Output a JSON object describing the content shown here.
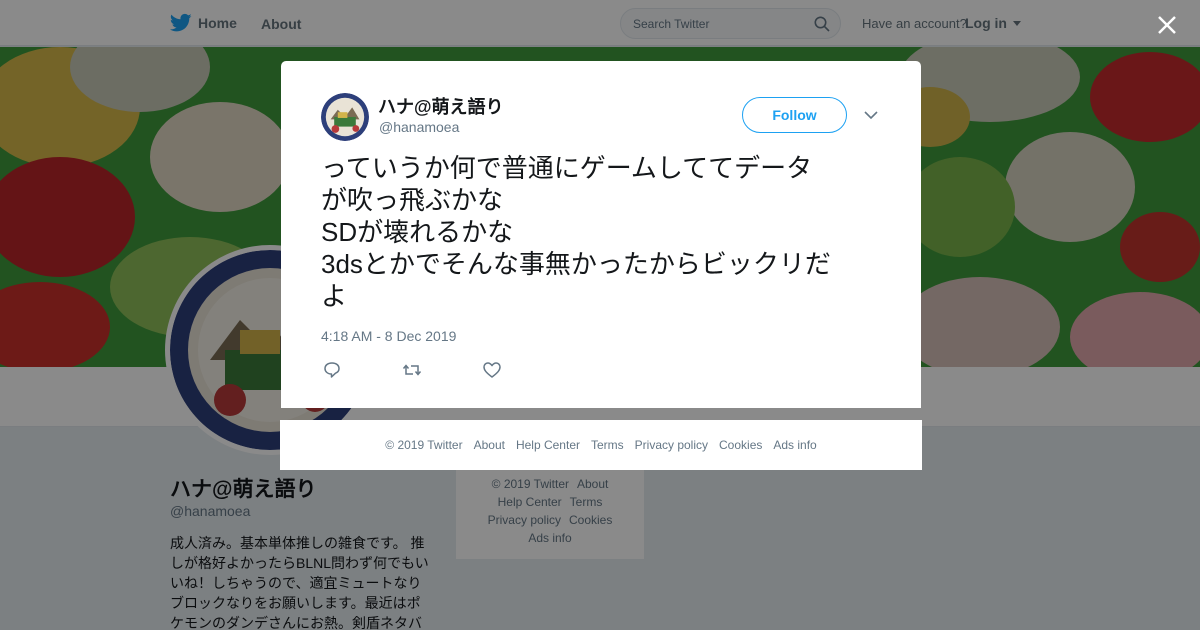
{
  "topbar": {
    "home_label": "Home",
    "about_label": "About",
    "search_placeholder": "Search Twitter",
    "have_account": "Have an account?",
    "login_label": "Log in"
  },
  "profile": {
    "name": "ハナ@萌え語り",
    "handle": "@hanamoea",
    "bio": "成人済み。基本単体推しの雑食です。 推しが格好よかったらBLNL問わず何でもいいね！しちゃうので、適宜ミュートなりブロックなりをお願いします。最近はポケモンのダンデさんにお熱。剣盾ネタバ"
  },
  "side_footer": {
    "row1": [
      "© 2019 Twitter",
      "About"
    ],
    "row2": [
      "Help Center",
      "Terms"
    ],
    "row3": [
      "Privacy policy",
      "Cookies"
    ],
    "row4": [
      "Ads info"
    ]
  },
  "tweet": {
    "name": "ハナ@萌え語り",
    "handle": "@hanamoea",
    "follow_label": "Follow",
    "lines": [
      "っていうか何で普通にゲームしててデータ",
      "が吹っ飛ぶかな",
      "SDが壊れるかな",
      "3dsとかでそんな事無かったからビックリだ",
      "よ"
    ],
    "timestamp": "4:18 AM - 8 Dec 2019"
  },
  "modal_footer": {
    "items": [
      "© 2019 Twitter",
      "About",
      "Help Center",
      "Terms",
      "Privacy policy",
      "Cookies",
      "Ads info"
    ]
  },
  "colors": {
    "accent": "#1da1f2",
    "secondary_text": "#657786",
    "banner_green": "#3f9a3c"
  },
  "icons": [
    "twitter-bird-icon",
    "search-icon",
    "caret-down-icon",
    "close-icon",
    "reply-icon",
    "retweet-icon",
    "like-icon",
    "chevron-down-icon"
  ]
}
